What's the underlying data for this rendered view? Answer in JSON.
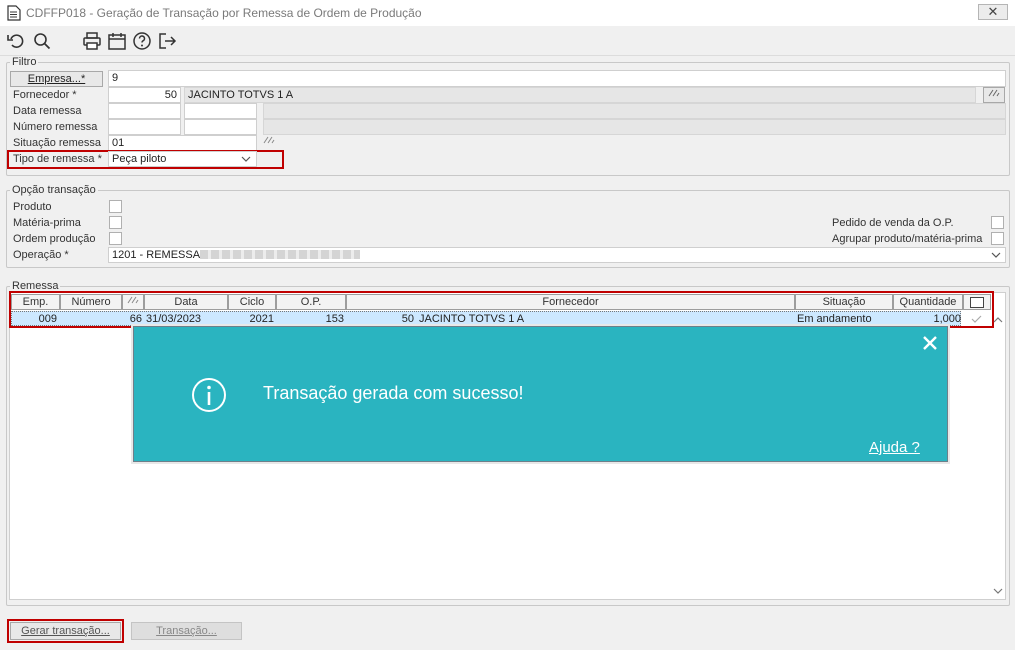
{
  "window": {
    "title": "CDFFP018 - Geração de Transação por Remessa de Ordem de Produção",
    "close_label": "✕"
  },
  "toolbar": {
    "icons": [
      "undo-icon",
      "search-icon",
      "print-icon",
      "calendar-icon",
      "help-icon",
      "exit-icon"
    ]
  },
  "filtro": {
    "legend": "Filtro",
    "empresa_button": "Empresa...*",
    "empresa_value": "9",
    "fornecedor_label": "Fornecedor *",
    "fornecedor_code": "50",
    "fornecedor_name": "JACINTO TOTVS 1 A",
    "data_remessa_label": "Data remessa",
    "numero_remessa_label": "Número remessa",
    "situacao_remessa_label": "Situação remessa",
    "situacao_remessa_value": "01",
    "tipo_remessa_label": "Tipo de remessa *",
    "tipo_remessa_value": "Peça piloto"
  },
  "opcao": {
    "legend": "Opção transação",
    "produto_label": "Produto",
    "materia_prima_label": "Matéria-prima",
    "ordem_producao_label": "Ordem produção",
    "operacao_label": "Operação *",
    "operacao_value": "1201 - REMESSA",
    "pedido_venda_label": "Pedido de venda da O.P.",
    "agrupar_label": "Agrupar produto/matéria-prima"
  },
  "remessa": {
    "legend": "Remessa",
    "columns": [
      "Emp.",
      "Número",
      "",
      "Data",
      "Ciclo",
      "O.P.",
      "Fornecedor",
      "Situação",
      "Quantidade"
    ],
    "row": {
      "emp": "009",
      "numero": "66",
      "data": "31/03/2023",
      "ciclo": "2021",
      "op": "153",
      "forn_code": "50",
      "forn_name": "JACINTO TOTVS 1 A",
      "situacao": "Em andamento",
      "quantidade": "1,000"
    }
  },
  "toast": {
    "message": "Transação gerada com sucesso!",
    "help_link": "Ajuda ?"
  },
  "footer": {
    "gerar_button": "Gerar transação...",
    "transacao_button": "Transação..."
  }
}
